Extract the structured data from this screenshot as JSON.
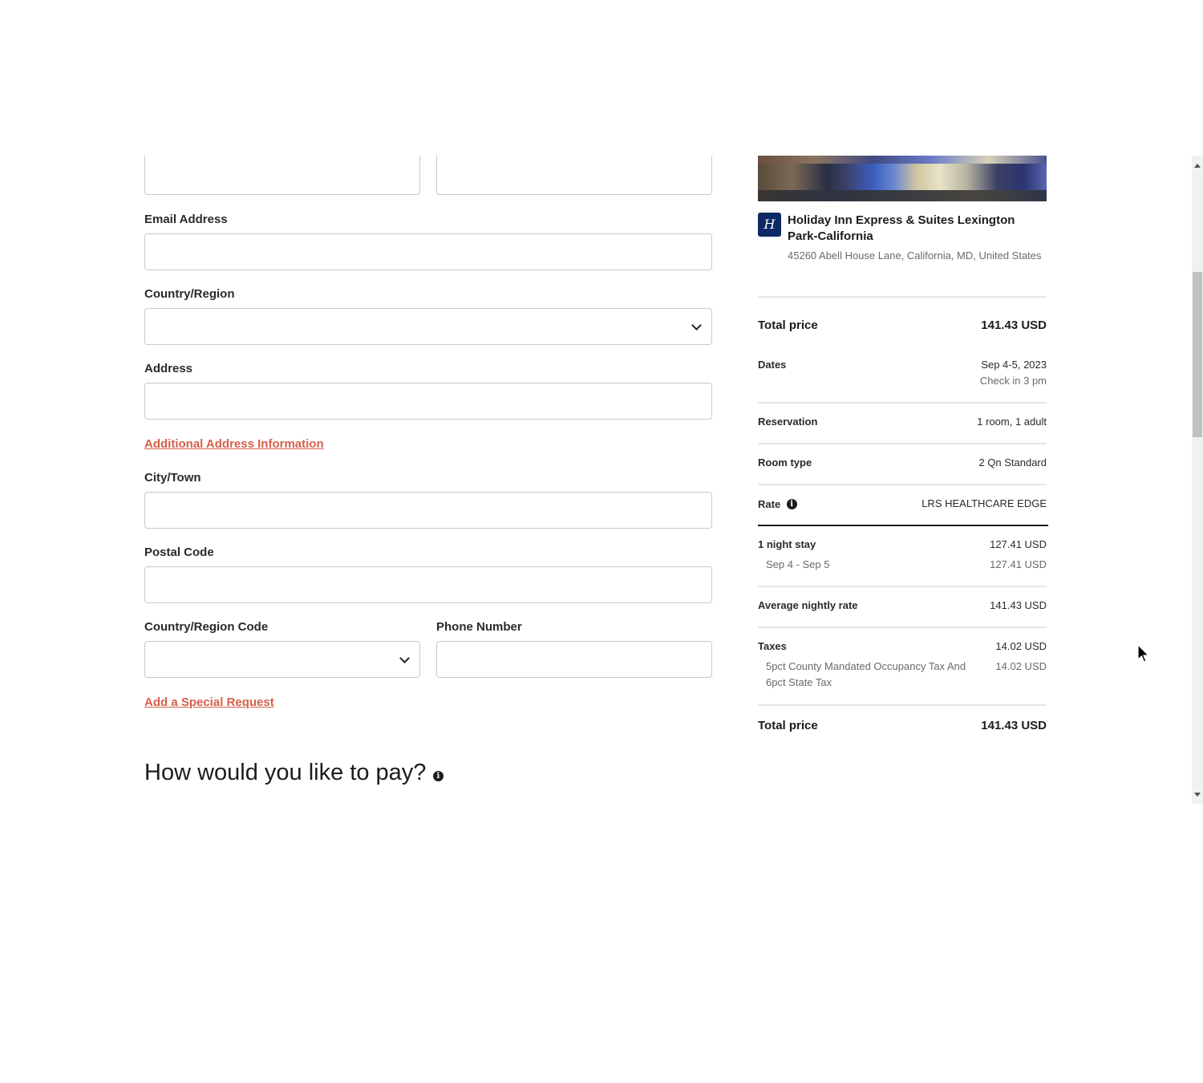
{
  "form": {
    "email_label": "Email Address",
    "email_value": "",
    "country_label": "Country/Region",
    "country_value": "",
    "address_label": "Address",
    "address_value": "",
    "additional_address_link": "Additional Address Information",
    "city_label": "City/Town",
    "city_value": "",
    "postal_label": "Postal Code",
    "postal_value": "",
    "country_code_label": "Country/Region Code",
    "country_code_value": "",
    "phone_label": "Phone Number",
    "phone_value": "",
    "special_request_link": "Add a Special Request",
    "pay_heading": "How would you like to pay?",
    "info_glyph": "i"
  },
  "summary": {
    "hotel_logo_glyph": "H",
    "hotel_name": "Holiday Inn Express & Suites Lexington Park-California",
    "hotel_address": "45260 Abell House Lane, California, MD, United States",
    "total_price_label": "Total price",
    "total_price_value": "141.43 USD",
    "dates_label": "Dates",
    "dates_value": "Sep 4-5, 2023",
    "checkin_value": "Check in 3 pm",
    "reservation_label": "Reservation",
    "reservation_value": "1 room, 1 adult",
    "room_type_label": "Room type",
    "room_type_value": "2 Qn Standard",
    "rate_label": "Rate",
    "rate_value": "LRS HEALTHCARE EDGE",
    "night_stay_label": "1 night stay",
    "night_stay_value": "127.41 USD",
    "night_range_label": "Sep 4 - Sep 5",
    "night_range_value": "127.41 USD",
    "avg_rate_label": "Average nightly rate",
    "avg_rate_value": "141.43 USD",
    "taxes_label": "Taxes",
    "taxes_value": "14.02 USD",
    "tax_detail_label": "5pct County Mandated Occupancy Tax And 6pct State Tax",
    "tax_detail_value": "14.02 USD",
    "grand_total_label": "Total price",
    "grand_total_value": "141.43 USD"
  },
  "colors": {
    "link": "#d5604a",
    "brand_logo": "#0e2a64",
    "text": "#1c1c1c"
  },
  "icons": {
    "select_chevron": "chevron-down-icon",
    "info": "info-icon",
    "cursor": "mouse-cursor-icon",
    "scroll_up": "scroll-up-arrow-icon",
    "scroll_down": "scroll-down-arrow-icon"
  }
}
